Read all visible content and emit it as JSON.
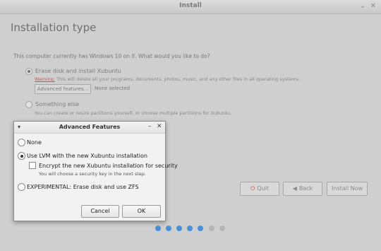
{
  "window": {
    "title": "Install",
    "minimize_glyph": "⌄",
    "close_glyph": "✕"
  },
  "page": {
    "title": "Installation type",
    "question": "This computer currently has Windows 10 on it. What would you like to do?"
  },
  "options": {
    "erase": {
      "label": "Erase disk and install Xubuntu",
      "warning_label": "Warning:",
      "warning_text": " This will delete all your programs, documents, photos, music, and any other files in all operating systems.",
      "advanced_button": "Advanced features...",
      "advanced_status": "None selected",
      "selected": true
    },
    "something_else": {
      "label": "Something else",
      "description": "You can create or resize partitions yourself, or choose multiple partitions for Xubuntu.",
      "selected": false
    }
  },
  "navigation": {
    "quit_label": "Quit",
    "back_label": "Back",
    "install_label": "Install Now",
    "quit_icon": "power-icon",
    "back_icon": "arrow-left-icon"
  },
  "progress_dots": {
    "total": 7,
    "completed": 5,
    "colors": {
      "done": "#4a90d9",
      "pending": "#b5b5b5"
    }
  },
  "dialog": {
    "title": "Advanced Features",
    "menu_glyph": "▾",
    "minimize_glyph": "–",
    "close_glyph": "✕",
    "options": {
      "none": {
        "label": "None",
        "selected": false
      },
      "lvm": {
        "label": "Use LVM with the new Xubuntu installation",
        "selected": true
      },
      "encrypt": {
        "label": "Encrypt the new Xubuntu installation for security",
        "note": "You will choose a security key in the next step.",
        "checked": false
      },
      "zfs": {
        "label": "EXPERIMENTAL: Erase disk and use ZFS",
        "selected": false
      }
    },
    "cancel_label": "Cancel",
    "ok_label": "OK"
  }
}
